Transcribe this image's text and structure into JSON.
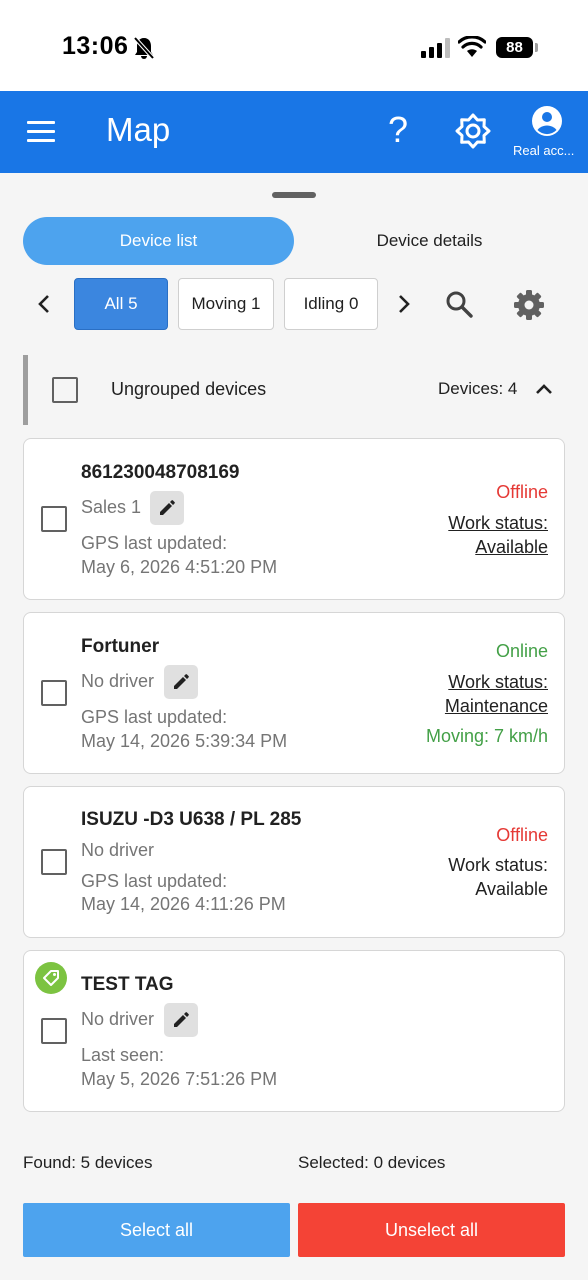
{
  "status_bar": {
    "time": "13:06",
    "battery": "88"
  },
  "app_bar": {
    "title": "Map",
    "help_glyph": "?",
    "account_label": "Real acc..."
  },
  "tabs": [
    {
      "label": "Device list",
      "active": true
    },
    {
      "label": "Device details",
      "active": false
    }
  ],
  "filters": [
    {
      "label": "All 5",
      "active": true
    },
    {
      "label": "Moving 1",
      "active": false
    },
    {
      "label": "Idling 0",
      "active": false
    }
  ],
  "group": {
    "title": "Ungrouped devices",
    "count_label": "Devices: 4"
  },
  "devices": [
    {
      "name": "861230048708169",
      "driver": "Sales 1",
      "time_label": "GPS last updated:",
      "time_value": "May 6, 2026 4:51:20 PM",
      "status": "Offline",
      "work_label": "Work status:",
      "work_value": "Available",
      "moving": ""
    },
    {
      "name": "Fortuner",
      "driver": "No driver",
      "time_label": "GPS last updated:",
      "time_value": "May 14, 2026 5:39:34 PM",
      "status": "Online",
      "work_label": "Work status:",
      "work_value": "Maintenance",
      "moving": "Moving: 7 km/h"
    },
    {
      "name": "ISUZU -D3 U638 / PL 285",
      "driver": "No driver",
      "time_label": "GPS last updated:",
      "time_value": "May 14, 2026 4:11:26 PM",
      "status": "Offline",
      "work_label": "Work status:",
      "work_value": "Available",
      "moving": ""
    },
    {
      "name": "TEST TAG",
      "driver": "No driver",
      "time_label": "Last seen:",
      "time_value": "May 5, 2026 7:51:26 PM",
      "status": "",
      "work_label": "",
      "work_value": "",
      "moving": ""
    }
  ],
  "footer": {
    "found": "Found: 5 devices",
    "selected": "Selected: 0 devices",
    "select_all": "Select all",
    "unselect_all": "Unselect all"
  },
  "colors": {
    "app_bar": "#1976e6",
    "accent": "#4da3ee",
    "offline": "#e53935",
    "online": "#43a047",
    "unselect": "#f44336",
    "tag": "#7cc341"
  },
  "icons": [
    "bell-off-icon",
    "signal-icon",
    "wifi-icon",
    "menu-icon",
    "help-icon",
    "brightness-icon",
    "account-icon",
    "chevron-left-icon",
    "chevron-right-icon",
    "search-icon",
    "gear-icon",
    "chevron-up-icon",
    "edit-icon",
    "tag-icon"
  ]
}
